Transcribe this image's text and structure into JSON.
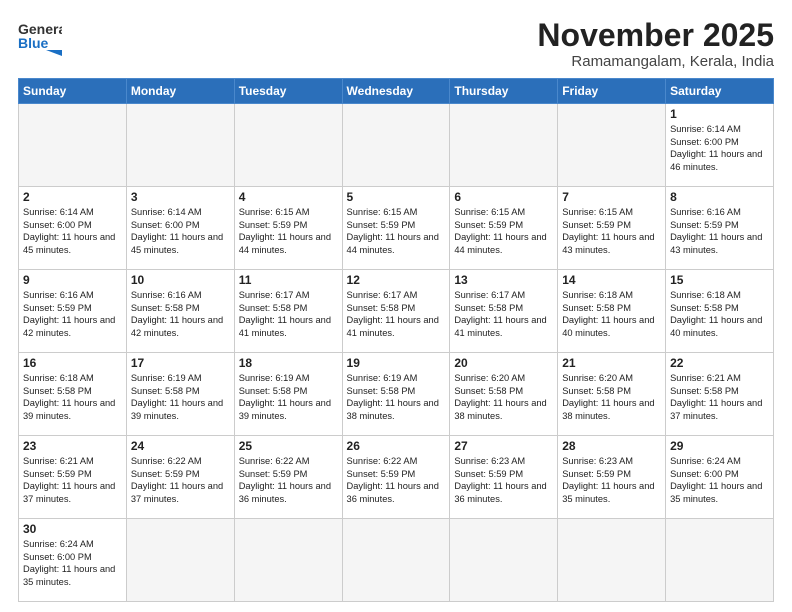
{
  "header": {
    "logo_general": "General",
    "logo_blue": "Blue",
    "month_title": "November 2025",
    "location": "Ramamangalam, Kerala, India"
  },
  "weekdays": [
    "Sunday",
    "Monday",
    "Tuesday",
    "Wednesday",
    "Thursday",
    "Friday",
    "Saturday"
  ],
  "weeks": [
    [
      {
        "day": "",
        "empty": true
      },
      {
        "day": "",
        "empty": true
      },
      {
        "day": "",
        "empty": true
      },
      {
        "day": "",
        "empty": true
      },
      {
        "day": "",
        "empty": true
      },
      {
        "day": "",
        "empty": true
      },
      {
        "day": "1",
        "sunrise": "6:14 AM",
        "sunset": "6:00 PM",
        "daylight": "11 hours and 46 minutes."
      }
    ],
    [
      {
        "day": "2",
        "sunrise": "6:14 AM",
        "sunset": "6:00 PM",
        "daylight": "11 hours and 45 minutes."
      },
      {
        "day": "3",
        "sunrise": "6:14 AM",
        "sunset": "6:00 PM",
        "daylight": "11 hours and 45 minutes."
      },
      {
        "day": "4",
        "sunrise": "6:15 AM",
        "sunset": "5:59 PM",
        "daylight": "11 hours and 44 minutes."
      },
      {
        "day": "5",
        "sunrise": "6:15 AM",
        "sunset": "5:59 PM",
        "daylight": "11 hours and 44 minutes."
      },
      {
        "day": "6",
        "sunrise": "6:15 AM",
        "sunset": "5:59 PM",
        "daylight": "11 hours and 44 minutes."
      },
      {
        "day": "7",
        "sunrise": "6:15 AM",
        "sunset": "5:59 PM",
        "daylight": "11 hours and 43 minutes."
      },
      {
        "day": "8",
        "sunrise": "6:16 AM",
        "sunset": "5:59 PM",
        "daylight": "11 hours and 43 minutes."
      }
    ],
    [
      {
        "day": "9",
        "sunrise": "6:16 AM",
        "sunset": "5:59 PM",
        "daylight": "11 hours and 42 minutes."
      },
      {
        "day": "10",
        "sunrise": "6:16 AM",
        "sunset": "5:58 PM",
        "daylight": "11 hours and 42 minutes."
      },
      {
        "day": "11",
        "sunrise": "6:17 AM",
        "sunset": "5:58 PM",
        "daylight": "11 hours and 41 minutes."
      },
      {
        "day": "12",
        "sunrise": "6:17 AM",
        "sunset": "5:58 PM",
        "daylight": "11 hours and 41 minutes."
      },
      {
        "day": "13",
        "sunrise": "6:17 AM",
        "sunset": "5:58 PM",
        "daylight": "11 hours and 41 minutes."
      },
      {
        "day": "14",
        "sunrise": "6:18 AM",
        "sunset": "5:58 PM",
        "daylight": "11 hours and 40 minutes."
      },
      {
        "day": "15",
        "sunrise": "6:18 AM",
        "sunset": "5:58 PM",
        "daylight": "11 hours and 40 minutes."
      }
    ],
    [
      {
        "day": "16",
        "sunrise": "6:18 AM",
        "sunset": "5:58 PM",
        "daylight": "11 hours and 39 minutes."
      },
      {
        "day": "17",
        "sunrise": "6:19 AM",
        "sunset": "5:58 PM",
        "daylight": "11 hours and 39 minutes."
      },
      {
        "day": "18",
        "sunrise": "6:19 AM",
        "sunset": "5:58 PM",
        "daylight": "11 hours and 39 minutes."
      },
      {
        "day": "19",
        "sunrise": "6:19 AM",
        "sunset": "5:58 PM",
        "daylight": "11 hours and 38 minutes."
      },
      {
        "day": "20",
        "sunrise": "6:20 AM",
        "sunset": "5:58 PM",
        "daylight": "11 hours and 38 minutes."
      },
      {
        "day": "21",
        "sunrise": "6:20 AM",
        "sunset": "5:58 PM",
        "daylight": "11 hours and 38 minutes."
      },
      {
        "day": "22",
        "sunrise": "6:21 AM",
        "sunset": "5:58 PM",
        "daylight": "11 hours and 37 minutes."
      }
    ],
    [
      {
        "day": "23",
        "sunrise": "6:21 AM",
        "sunset": "5:59 PM",
        "daylight": "11 hours and 37 minutes."
      },
      {
        "day": "24",
        "sunrise": "6:22 AM",
        "sunset": "5:59 PM",
        "daylight": "11 hours and 37 minutes."
      },
      {
        "day": "25",
        "sunrise": "6:22 AM",
        "sunset": "5:59 PM",
        "daylight": "11 hours and 36 minutes."
      },
      {
        "day": "26",
        "sunrise": "6:22 AM",
        "sunset": "5:59 PM",
        "daylight": "11 hours and 36 minutes."
      },
      {
        "day": "27",
        "sunrise": "6:23 AM",
        "sunset": "5:59 PM",
        "daylight": "11 hours and 36 minutes."
      },
      {
        "day": "28",
        "sunrise": "6:23 AM",
        "sunset": "5:59 PM",
        "daylight": "11 hours and 35 minutes."
      },
      {
        "day": "29",
        "sunrise": "6:24 AM",
        "sunset": "6:00 PM",
        "daylight": "11 hours and 35 minutes."
      }
    ],
    [
      {
        "day": "30",
        "sunrise": "6:24 AM",
        "sunset": "6:00 PM",
        "daylight": "11 hours and 35 minutes."
      },
      {
        "day": "",
        "empty": true
      },
      {
        "day": "",
        "empty": true
      },
      {
        "day": "",
        "empty": true
      },
      {
        "day": "",
        "empty": true
      },
      {
        "day": "",
        "empty": true
      },
      {
        "day": "",
        "empty": true
      }
    ]
  ],
  "labels": {
    "sunrise": "Sunrise:",
    "sunset": "Sunset:",
    "daylight": "Daylight:"
  }
}
